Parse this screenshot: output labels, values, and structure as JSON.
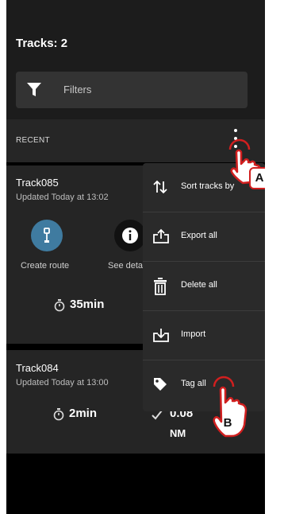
{
  "header": {
    "title": "Tracks: 2"
  },
  "filters": {
    "label": "Filters"
  },
  "section": {
    "label": "RECENT"
  },
  "tracks": [
    {
      "name": "Track085",
      "updated": "Updated Today at 13:02",
      "duration": "35min",
      "actions": [
        {
          "label": "Create route"
        },
        {
          "label": "See deta"
        }
      ]
    },
    {
      "name": "Track084",
      "updated": "Updated Today at 13:00",
      "duration": "2min",
      "distance_value": "0.08",
      "distance_unit": "NM"
    }
  ],
  "menu": {
    "items": [
      {
        "label": "Sort tracks by",
        "icon": "sort-icon"
      },
      {
        "label": "Export all",
        "icon": "export-icon"
      },
      {
        "label": "Delete all",
        "icon": "trash-icon"
      },
      {
        "label": "Import",
        "icon": "import-icon"
      },
      {
        "label": "Tag all",
        "icon": "tag-icon"
      }
    ]
  },
  "annotations": {
    "a": "A",
    "b": "B"
  },
  "colors": {
    "accent": "#3f7ba0",
    "annotation": "#d11f1f"
  }
}
